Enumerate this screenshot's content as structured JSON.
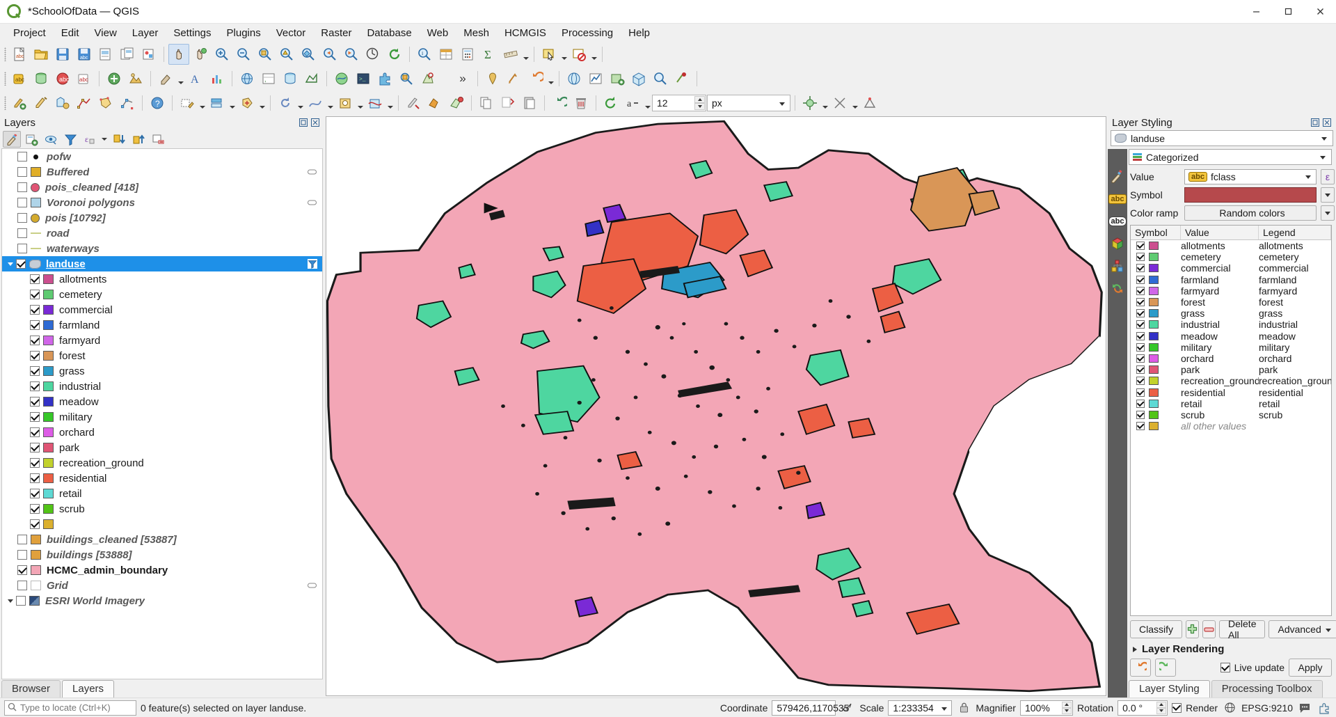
{
  "window": {
    "title": "*SchoolOfData — QGIS",
    "minimize_label": "Minimize",
    "maximize_label": "Maximize",
    "close_label": "Close"
  },
  "menubar": {
    "items": [
      "Project",
      "Edit",
      "View",
      "Layer",
      "Settings",
      "Plugins",
      "Vector",
      "Raster",
      "Database",
      "Web",
      "Mesh",
      "HCMGIS",
      "Processing",
      "Help"
    ]
  },
  "toolbars": {
    "font_size_value": "12",
    "font_unit_value": "px",
    "overflow_label": "»"
  },
  "layers_panel": {
    "title": "Layers",
    "toolbar_buttons": [
      "open-layer-styling-panel",
      "add-group",
      "manage-map-themes",
      "filter-legend",
      "filter-legend-by-expression",
      "expand-all",
      "collapse-all",
      "remove-layer"
    ],
    "items": [
      {
        "name": "pofw",
        "checked": false,
        "style": "group",
        "symbol": "dot",
        "color": "#111111",
        "indent": 1
      },
      {
        "name": "Buffered",
        "checked": false,
        "style": "group",
        "symbol": "square",
        "color": "#e0ae28",
        "indent": 1
      },
      {
        "name": "pois_cleaned [418]",
        "checked": false,
        "style": "group",
        "symbol": "circle",
        "color": "#e05575",
        "indent": 1
      },
      {
        "name": "Voronoi polygons",
        "checked": false,
        "style": "group",
        "symbol": "square",
        "color": "#afd4e8",
        "indent": 1
      },
      {
        "name": "pois [10792]",
        "checked": false,
        "style": "group",
        "symbol": "circle",
        "color": "#d4ab2e",
        "indent": 1
      },
      {
        "name": "road",
        "checked": false,
        "style": "group",
        "symbol": "line",
        "color": "#c9cf86",
        "indent": 1
      },
      {
        "name": "waterways",
        "checked": false,
        "style": "group",
        "symbol": "line",
        "color": "#c9cf86",
        "indent": 1
      },
      {
        "name": "landuse",
        "checked": true,
        "style": "selected",
        "symbol": "poly",
        "color": "#c6cdd6",
        "indent": 0,
        "selected": true,
        "has_filter_badge": true
      }
    ],
    "landuse_categories": [
      {
        "label": "allotments",
        "color": "#cc4f8f"
      },
      {
        "label": "cemetery",
        "color": "#5fcb72"
      },
      {
        "label": "commercial",
        "color": "#7a2ad6"
      },
      {
        "label": "farmland",
        "color": "#2f6bd4"
      },
      {
        "label": "farmyard",
        "color": "#d066e8"
      },
      {
        "label": "forest",
        "color": "#d99657"
      },
      {
        "label": "grass",
        "color": "#2c9bc9"
      },
      {
        "label": "industrial",
        "color": "#4ed6a0"
      },
      {
        "label": "meadow",
        "color": "#3331c6"
      },
      {
        "label": "military",
        "color": "#36c728"
      },
      {
        "label": "orchard",
        "color": "#dd5ce6"
      },
      {
        "label": "park",
        "color": "#e05575"
      },
      {
        "label": "recreation_ground",
        "color": "#c2d22c"
      },
      {
        "label": "residential",
        "color": "#ec5f44"
      },
      {
        "label": "retail",
        "color": "#5ed9d4"
      },
      {
        "label": "scrub",
        "color": "#52c416"
      },
      {
        "label": "",
        "color": "#dbb02f"
      }
    ],
    "bottom_items": [
      {
        "name": "buildings_cleaned [53887]",
        "checked": false,
        "style": "group",
        "color": "#e0a03c"
      },
      {
        "name": "buildings [53888]",
        "checked": false,
        "style": "group",
        "color": "#e0a03c"
      },
      {
        "name": "HCMC_admin_boundary",
        "checked": true,
        "style": "bold",
        "color": "#f3a6b6"
      },
      {
        "name": "Grid",
        "checked": false,
        "style": "group",
        "color": "#ffffff",
        "has_badge": true
      },
      {
        "name": "ESRI World Imagery",
        "checked": false,
        "style": "group",
        "symbol": "raster",
        "expander": true
      }
    ],
    "tabs": [
      {
        "label": "Browser",
        "active": false
      },
      {
        "label": "Layers",
        "active": true
      }
    ]
  },
  "layer_styling": {
    "title": "Layer Styling",
    "layer_combo_value": "landuse",
    "renderer_combo_value": "Categorized",
    "value_label": "Value",
    "value_field": "fclass",
    "value_field_prefix": "abc",
    "expression_button_label": "ε",
    "symbol_label": "Symbol",
    "symbol_color": "#b6494c",
    "colorramp_label": "Color ramp",
    "colorramp_value": "Random colors",
    "table_headers": [
      "Symbol",
      "Value",
      "Legend"
    ],
    "rows": [
      {
        "value": "allotments",
        "legend": "allotments",
        "color": "#cc4f8f",
        "checked": true
      },
      {
        "value": "cemetery",
        "legend": "cemetery",
        "color": "#5fcb72",
        "checked": true
      },
      {
        "value": "commercial",
        "legend": "commercial",
        "color": "#7a2ad6",
        "checked": true
      },
      {
        "value": "farmland",
        "legend": "farmland",
        "color": "#2f6bd4",
        "checked": true
      },
      {
        "value": "farmyard",
        "legend": "farmyard",
        "color": "#d066e8",
        "checked": true
      },
      {
        "value": "forest",
        "legend": "forest",
        "color": "#d99657",
        "checked": true
      },
      {
        "value": "grass",
        "legend": "grass",
        "color": "#2c9bc9",
        "checked": true
      },
      {
        "value": "industrial",
        "legend": "industrial",
        "color": "#4ed6a0",
        "checked": true
      },
      {
        "value": "meadow",
        "legend": "meadow",
        "color": "#3331c6",
        "checked": true
      },
      {
        "value": "military",
        "legend": "military",
        "color": "#36c728",
        "checked": true
      },
      {
        "value": "orchard",
        "legend": "orchard",
        "color": "#dd5ce6",
        "checked": true
      },
      {
        "value": "park",
        "legend": "park",
        "color": "#e05575",
        "checked": true
      },
      {
        "value": "recreation_ground",
        "legend": "recreation_ground",
        "color": "#c2d22c",
        "checked": true
      },
      {
        "value": "residential",
        "legend": "residential",
        "color": "#ec5f44",
        "checked": true
      },
      {
        "value": "retail",
        "legend": "retail",
        "color": "#5ed9d4",
        "checked": true
      },
      {
        "value": "scrub",
        "legend": "scrub",
        "color": "#52c416",
        "checked": true
      },
      {
        "value": "all other values",
        "legend": "",
        "color": "#dbb02f",
        "checked": true,
        "italic": true
      }
    ],
    "classify_label": "Classify",
    "add_label": "+",
    "remove_label": "−",
    "delete_all_label": "Delete All",
    "advanced_label": "Advanced",
    "layer_rendering_label": "Layer Rendering",
    "live_update_label": "Live update",
    "apply_label": "Apply",
    "tabs": [
      {
        "label": "Layer Styling",
        "active": true
      },
      {
        "label": "Processing Toolbox",
        "active": false
      }
    ]
  },
  "statusbar": {
    "locator_placeholder": "Type to locate (Ctrl+K)",
    "message": "0 feature(s) selected on layer landuse.",
    "coordinate_label": "Coordinate",
    "coordinate_value": "579426,1170535",
    "scale_label": "Scale",
    "scale_value": "1:233354",
    "magnifier_label": "Magnifier",
    "magnifier_value": "100%",
    "rotation_label": "Rotation",
    "rotation_value": "0.0 °",
    "render_label": "Render",
    "crs_label": "EPSG:9210"
  }
}
